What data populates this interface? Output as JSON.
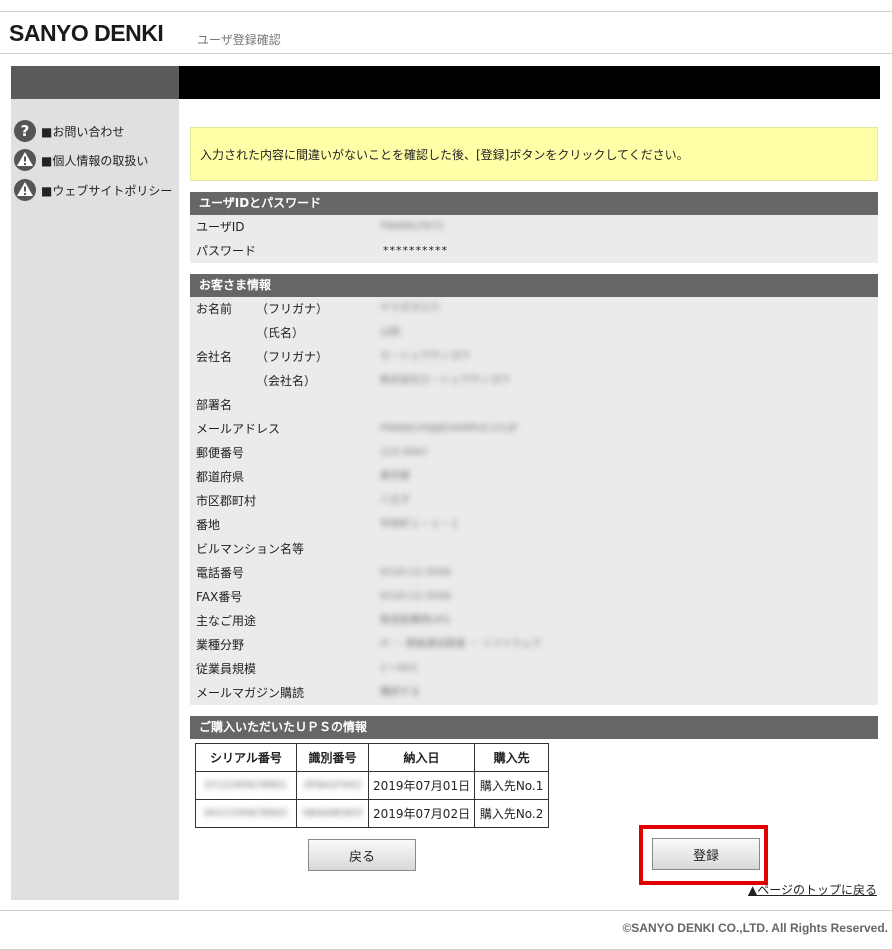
{
  "header": {
    "logo": "SANYO DENKI",
    "page_title": "ユーザ登録確認"
  },
  "sidebar": {
    "items": [
      {
        "label": "■お問い合わせ",
        "icon": "question-icon"
      },
      {
        "label": "■個人情報の取扱い",
        "icon": "warning-icon"
      },
      {
        "label": "■ウェブサイトポリシー",
        "icon": "warning-icon"
      }
    ]
  },
  "notice": "入力された内容に間違いがないことを確認した後、[登録]ボタンをクリックしてください。",
  "account_section": {
    "title": "ユーザIDとパスワード",
    "rows": [
      {
        "label": "ユーザID",
        "value": "FRANKLYN72"
      },
      {
        "label": "パスワード",
        "value": "**********"
      }
    ]
  },
  "customer_section": {
    "title": "お客さま情報",
    "name_label": "お名前",
    "name_kana_label": "（フリガナ）",
    "name_full_label": "（氏名）",
    "company_label": "会社名",
    "company_kana_label": "（フリガナ）",
    "company_name_label": "（会社名）",
    "fields": [
      "部署名",
      "メールアドレス",
      "郵便番号",
      "都道府県",
      "市区郡町村",
      "番地",
      "ビルマンション名等",
      "電話番号",
      "FAX番号",
      "主なご用途",
      "業種分野",
      "従業員規模",
      "メールマガジン購読"
    ],
    "values": {
      "name_kana": "ヤマダタロウ",
      "name_full": "山田",
      "company_kana": "カ－シュウサンヨウ",
      "company_name": "株式会社カ－シュウサンヨウ",
      "email": "FRANKLYN@EXAMPLE.CO.JP",
      "postal": "123-4567",
      "prefecture": "東京都",
      "city": "八王子",
      "address": "中央町１－１－１",
      "phone": "0120-12-3456",
      "fax": "0120-12-3456",
      "usage": "製造設備用UPS",
      "industry": "IT ・ 情報通信関連 ・ ソフトウェア",
      "employees": "1～49人",
      "newsletter": "購読する"
    }
  },
  "ups_section": {
    "title": "ご購入いただいたＵＰＳの情報",
    "columns": [
      "シリアル番号",
      "識別番号",
      "納入日",
      "購入先"
    ],
    "rows": [
      [
        "SY12345678901",
        "0F8A1F443",
        "2019年07月01日",
        "購入先No.1"
      ],
      [
        "SH12345678902",
        "0B4A0E4D3",
        "2019年07月02日",
        "購入先No.2"
      ]
    ]
  },
  "buttons": {
    "back": "戻る",
    "register": "登録"
  },
  "page_top": "▲ページのトップに戻る",
  "footer": {
    "copyright": "©SANYO DENKI CO.,LTD. All Rights Reserved."
  }
}
